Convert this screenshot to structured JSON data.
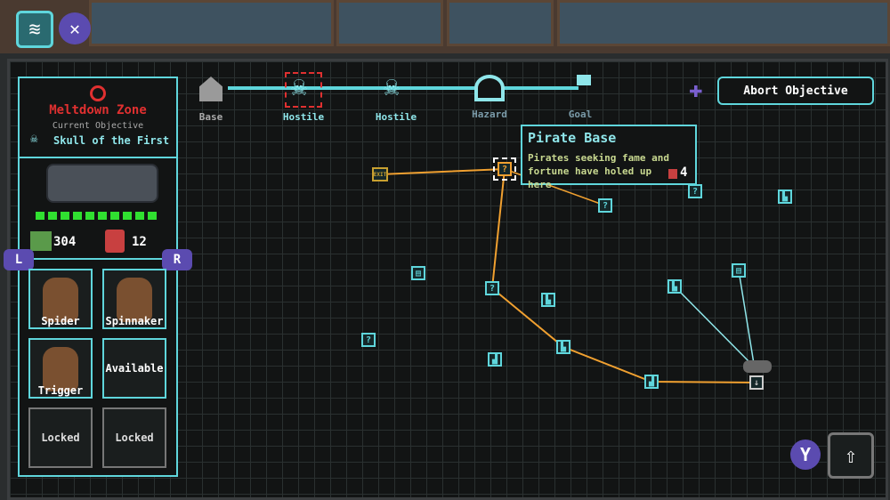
{
  "topbar": {
    "inventory_icon": "database-icon",
    "close_icon": "x-icon"
  },
  "objective": {
    "zone": "Meltdown Zone",
    "label": "Current Objective",
    "name": "Skull of the First"
  },
  "resources": {
    "scrap": "304",
    "fuel": "12"
  },
  "hull_pips": 10,
  "bumpers": {
    "left": "L",
    "right": "R",
    "y": "Y"
  },
  "crew": [
    {
      "name": "Spider"
    },
    {
      "name": "Spinnaker"
    },
    {
      "name": "Trigger"
    },
    {
      "name": "Available"
    },
    {
      "name": "Locked"
    },
    {
      "name": "Locked"
    }
  ],
  "track": [
    {
      "label": "Base",
      "icon": "house-icon"
    },
    {
      "label": "Hostile",
      "icon": "skull-icon"
    },
    {
      "label": "Hostile",
      "icon": "skull-icon"
    },
    {
      "label": "Hazard",
      "icon": "hazard-icon"
    },
    {
      "label": "Goal",
      "icon": "flag-icon"
    }
  ],
  "tooltip": {
    "title": "Pirate Base",
    "body": "Pirates seeking fame and fortune have holed up here",
    "cost": "4"
  },
  "abort_label": "Abort Objective",
  "exit_label": "EXIT",
  "colors": {
    "accent": "#5fd6dc",
    "route": "#f0a030",
    "danger": "#e03030"
  }
}
